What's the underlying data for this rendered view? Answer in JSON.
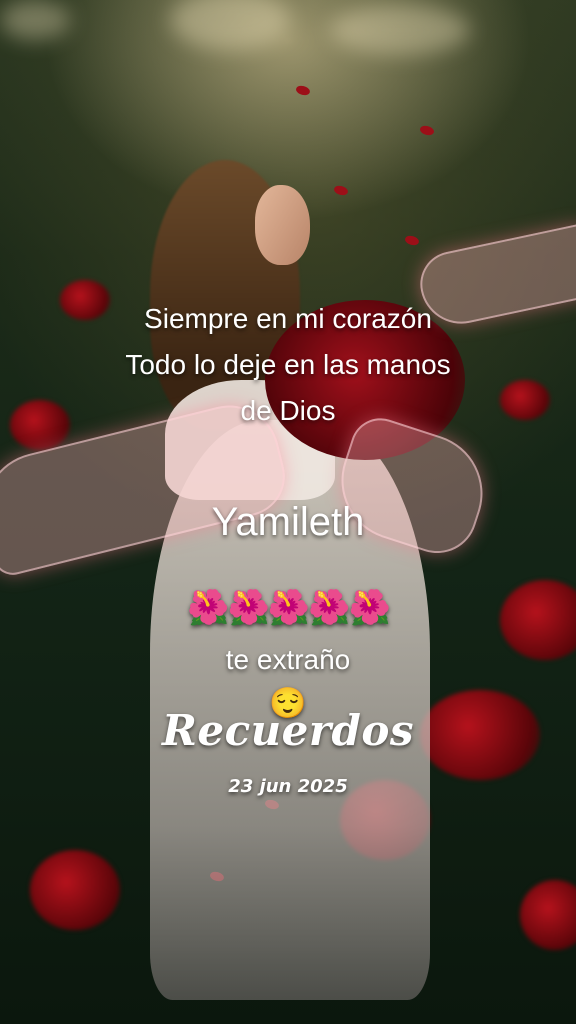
{
  "overlay": {
    "line_1": "Siempre en mi corazón",
    "line_2": "Todo lo deje en las manos",
    "line_3": "de Dios",
    "name": "Yamileth",
    "emoji_row": "🌺🌺🌺🌺🌺",
    "miss_text": "te extraño",
    "face_emoji": "😌",
    "title": "Recuerdos",
    "date": "23 jun 2025"
  },
  "colors": {
    "text": "#ffffff",
    "rose_red": "#b5121c",
    "hand_glow": "#ff7890",
    "background": "#132416"
  }
}
